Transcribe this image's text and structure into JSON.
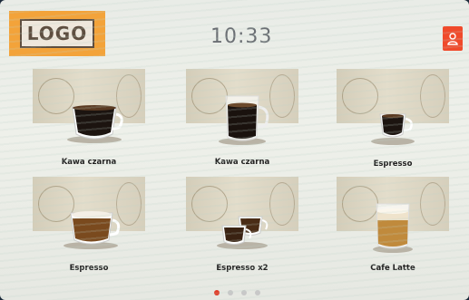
{
  "header": {
    "logo_text": "LOGO",
    "time": "10:33",
    "user_icon": "user-icon",
    "accent": "#f04a2b",
    "logo_bg": "#f3a33a"
  },
  "menu": {
    "items": [
      {
        "label": "Kawa czarna",
        "cup": "mug-black"
      },
      {
        "label": "Kawa czarna",
        "cup": "glass-black"
      },
      {
        "label": "Espresso",
        "cup": "small-cup"
      },
      {
        "label": "Espresso",
        "cup": "crema-cup"
      },
      {
        "label": "Espresso x2",
        "cup": "double-cup"
      },
      {
        "label": "Cafe Latte",
        "cup": "latte-glass"
      }
    ]
  },
  "pager": {
    "pages": 4,
    "current": 1
  }
}
